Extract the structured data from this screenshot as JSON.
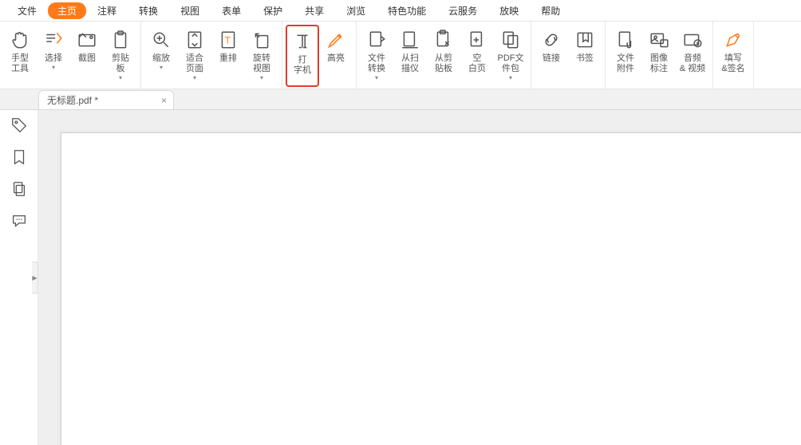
{
  "menu": {
    "items": [
      "文件",
      "主页",
      "注释",
      "转换",
      "视图",
      "表单",
      "保护",
      "共享",
      "浏览",
      "特色功能",
      "云服务",
      "放映",
      "帮助"
    ],
    "active_index": 1
  },
  "ribbon": {
    "groups": [
      {
        "buttons": [
          {
            "name": "hand-tool",
            "label": "手型\n工具",
            "icon": "hand"
          },
          {
            "name": "select",
            "label": "选择",
            "icon": "select",
            "drop": true
          },
          {
            "name": "snapshot",
            "label": "截图",
            "icon": "snapshot"
          },
          {
            "name": "clipboard",
            "label": "剪贴\n板",
            "icon": "clipboard",
            "drop": true
          }
        ]
      },
      {
        "buttons": [
          {
            "name": "zoom",
            "label": "缩放",
            "icon": "zoom",
            "drop": true
          },
          {
            "name": "fit-page",
            "label": "适合\n页面",
            "icon": "fitpage",
            "drop": true
          },
          {
            "name": "reflow",
            "label": "重排",
            "icon": "reflow"
          },
          {
            "name": "rotate-view",
            "label": "旋转\n视图",
            "icon": "rotate",
            "drop": true
          }
        ]
      },
      {
        "buttons": [
          {
            "name": "typewriter",
            "label": "打\n字机",
            "icon": "typewriter",
            "highlight": true
          },
          {
            "name": "highlight",
            "label": "高亮",
            "icon": "highlighter",
            "orange": true
          }
        ]
      },
      {
        "buttons": [
          {
            "name": "file-convert",
            "label": "文件\n转换",
            "icon": "fileconvert",
            "drop": true
          },
          {
            "name": "from-scanner",
            "label": "从扫\n描仪",
            "icon": "scanner"
          },
          {
            "name": "from-clipboard",
            "label": "从剪\n贴板",
            "icon": "fromclip"
          },
          {
            "name": "blank-page",
            "label": "空\n白页",
            "icon": "blankpage"
          },
          {
            "name": "pdf-package",
            "label": "PDF文\n件包",
            "icon": "package",
            "drop": true
          }
        ]
      },
      {
        "buttons": [
          {
            "name": "link",
            "label": "链接",
            "icon": "link"
          },
          {
            "name": "bookmark",
            "label": "书签",
            "icon": "bookmark"
          }
        ]
      },
      {
        "buttons": [
          {
            "name": "file-attach",
            "label": "文件\n附件",
            "icon": "attach"
          },
          {
            "name": "image-annot",
            "label": "图像\n标注",
            "icon": "imageannot"
          },
          {
            "name": "audio-video",
            "label": "音频\n& 视频",
            "icon": "media"
          }
        ]
      },
      {
        "buttons": [
          {
            "name": "fill-sign",
            "label": "填写\n&签名",
            "icon": "sign",
            "orange": true
          }
        ]
      }
    ]
  },
  "tab": {
    "title": "无标题.pdf *"
  },
  "sidebar": {
    "items": [
      {
        "name": "tag-panel",
        "icon": "tag"
      },
      {
        "name": "bookmark-panel",
        "icon": "ribbonmark"
      },
      {
        "name": "pages-panel",
        "icon": "pagecopy"
      },
      {
        "name": "comments-panel",
        "icon": "speech"
      }
    ]
  }
}
